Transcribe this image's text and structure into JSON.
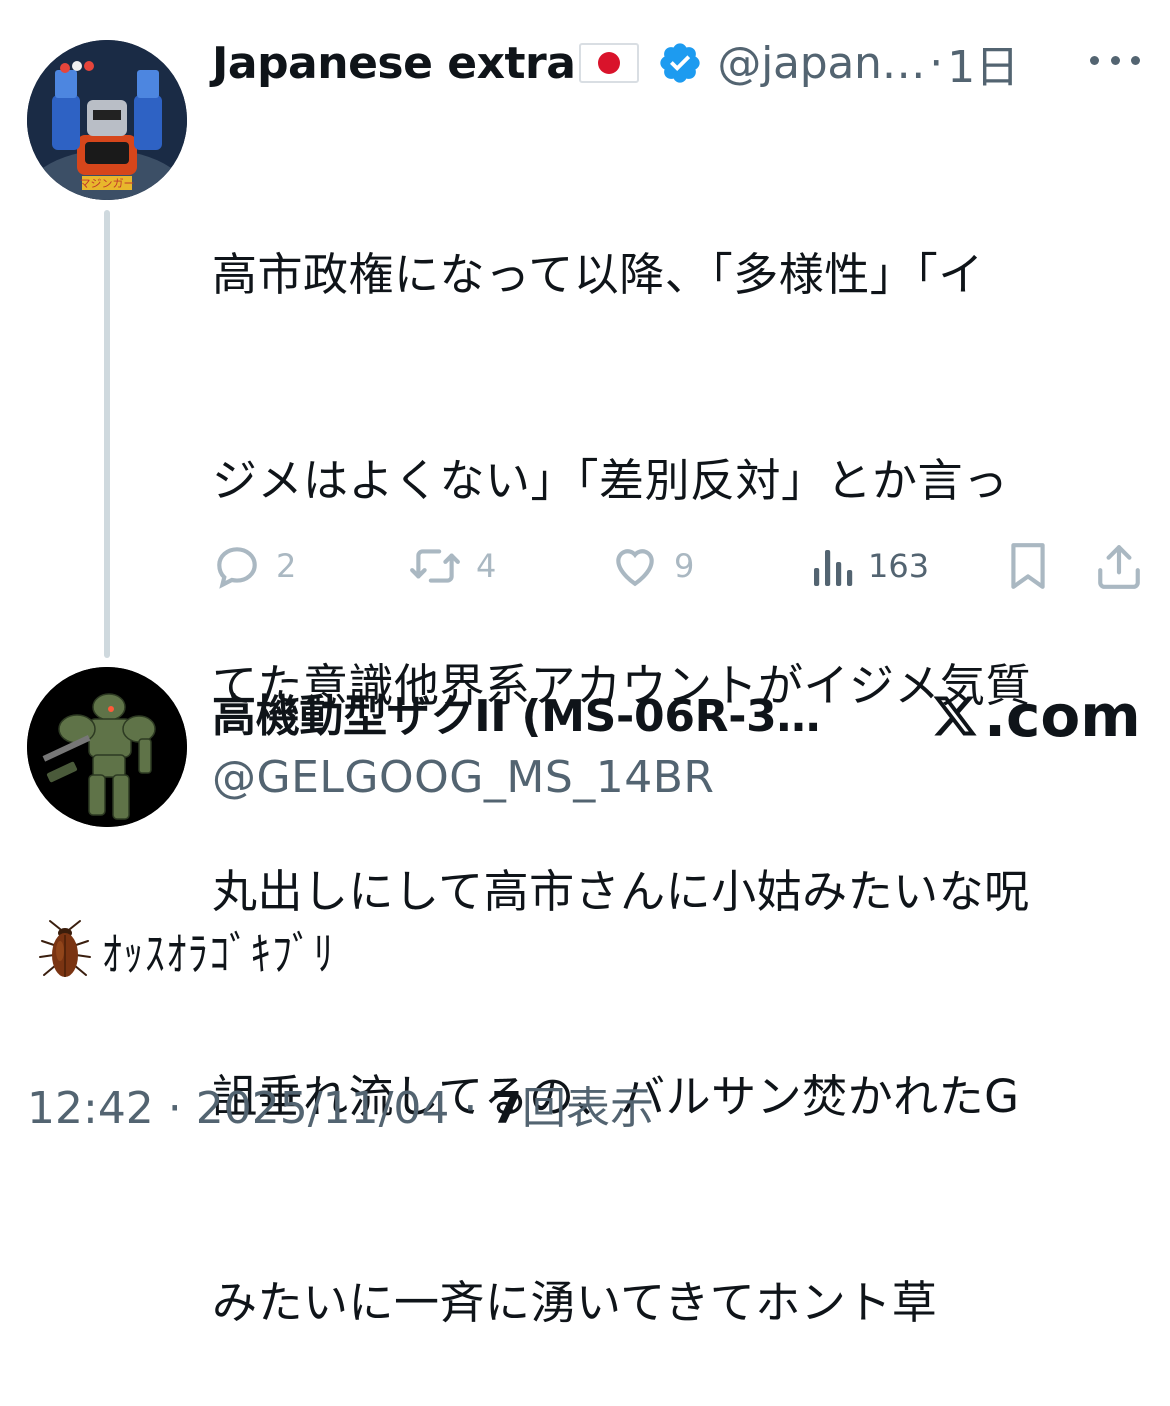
{
  "quoted": {
    "author_name": "Japanese extra",
    "handle": "@japan…",
    "separator": "·",
    "time": "1日",
    "text": "高市政権になって以降、「多様性」「イジメはよくない」「差別反対」とか言ってた意識他界系アカウントがイジメ気質丸出しにして高市さんに小姑みたいな呪詛垂れ流してるの、バルサン焚かれたGみたいに一斉に湧いてきてホント草",
    "lines": [
      "高市政権になって以降、「多様性」「イ",
      "ジメはよくない」「差別反対」とか言っ",
      "てた意識他界系アカウントがイジメ気質",
      "丸出しにして高市さんに小姑みたいな呪",
      "詛垂れ流してるの、バルサン焚かれたG",
      "みたいに一斉に湧いてきてホント草"
    ],
    "counts": {
      "replies": "2",
      "reposts": "4",
      "likes": "9",
      "views": "163"
    },
    "icons": [
      "verified-badge-icon",
      "japan-flag-icon",
      "more-icon",
      "reply-icon",
      "repost-icon",
      "like-icon",
      "views-icon",
      "bookmark-icon",
      "share-icon"
    ]
  },
  "card": {
    "author_name": "高機動型ザクII (MS-06R-3…",
    "handle": "@GELGOOG_MS_14BR",
    "site": ".com",
    "site_logo": "x-logo-icon"
  },
  "reply": {
    "emoji": "cockroach-icon",
    "text": "ｵｯｽｵﾗｺﾞｷﾌﾞﾘ"
  },
  "meta": {
    "time": "12:42",
    "dot1": " · ",
    "date": "2025/11/04",
    "dot2": " · ",
    "views_count": "7",
    "views_label": "回表示"
  },
  "colors": {
    "text": "#0f1419",
    "secondary": "#536471",
    "action": "#aab8c2",
    "verified": "#1d9bf0",
    "flag_red": "#d9132b",
    "thread_line": "#cfd9de"
  }
}
